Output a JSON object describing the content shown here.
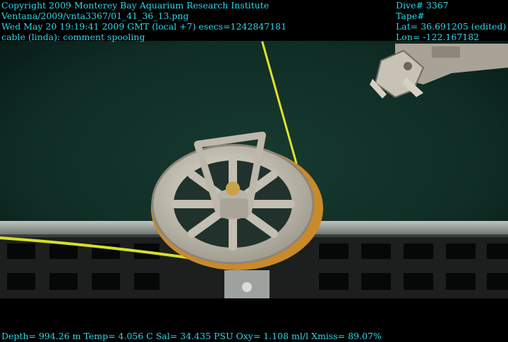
{
  "overlay": {
    "top_left": [
      "Copyright 2009 Monterey Bay Aquarium Research Institute",
      "Ventana/2009/vnta3367/01_41_36_13.png",
      "Wed May 20 19:19:41 2009 GMT (local +7)  esecs=1242847181",
      "cable (linda): comment spooling"
    ],
    "top_right": [
      "Dive# 3367",
      "Tape#",
      "Lat= 36.691205 (edited)",
      "Lon= -122.167182"
    ],
    "bottom": "Depth= 994.26 m  Temp= 4.056 C  Sal= 34.435 PSU  Oxy= 1.108 ml/l  Xmiss= 89.07%"
  },
  "scene": {
    "description_icons": [
      "pulley-wheel-icon",
      "robotic-arm-icon",
      "yellow-cable-icon",
      "metal-grate-icon"
    ],
    "colors": {
      "water": "#0d2a22",
      "cable": "#e2e22a",
      "wheel": "#c9c4b8",
      "wheel_rim": "#c98a2a",
      "overlay_text": "#2ad8e8"
    }
  }
}
